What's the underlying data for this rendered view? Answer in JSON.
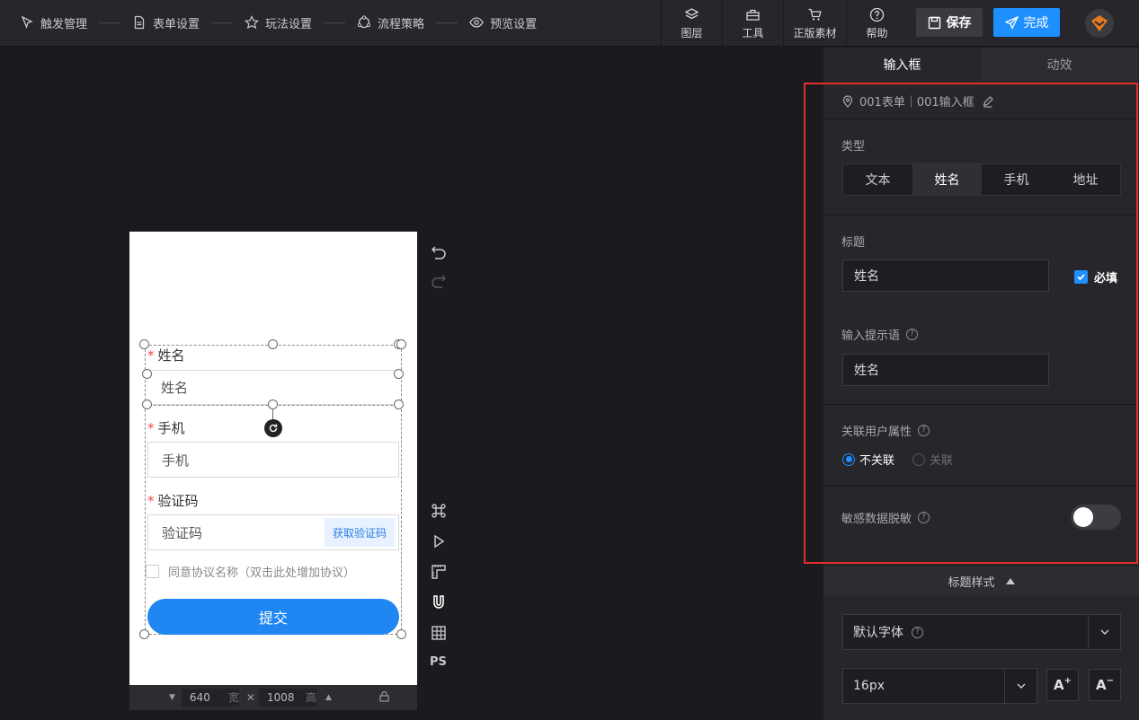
{
  "steps": [
    {
      "label": "触发管理",
      "icon": "cursor-icon"
    },
    {
      "label": "表单设置",
      "icon": "document-icon"
    },
    {
      "label": "玩法设置",
      "icon": "star-icon"
    },
    {
      "label": "流程策略",
      "icon": "flow-icon"
    },
    {
      "label": "预览设置",
      "icon": "eye-icon"
    }
  ],
  "tools": {
    "layers": "图层",
    "tools": "工具",
    "assets": "正版素材",
    "help": "帮助"
  },
  "buttons": {
    "save": "保存",
    "done": "完成"
  },
  "phone": {
    "name_label": "姓名",
    "name_placeholder": "姓名",
    "phone_label": "手机",
    "phone_placeholder": "手机",
    "code_label": "验证码",
    "code_placeholder": "验证码",
    "get_code": "获取验证码",
    "agree_text": "同意协议名称（双击此处增加协议）",
    "submit": "提交",
    "required_mark": "*"
  },
  "sizebar": {
    "width_value": "640",
    "width_unit": "宽",
    "times": "✕",
    "height_value": "1008",
    "height_unit": "高"
  },
  "panel": {
    "tabs": [
      "输入框",
      "动效"
    ],
    "breadcrumb": "001表单｜001输入框",
    "type_label": "类型",
    "types": [
      "文本",
      "姓名",
      "手机",
      "地址"
    ],
    "active_type": "姓名",
    "title_label": "标题",
    "title_value": "姓名",
    "required_label": "必填",
    "placeholder_label": "输入提示语",
    "placeholder_value": "姓名",
    "user_attr_label": "关联用户属性",
    "user_attr_options": [
      "不关联",
      "关联"
    ],
    "user_attr_selected": "不关联",
    "mask_label": "敏感数据脱敏",
    "mask_enabled": false,
    "title_style_label": "标题样式",
    "font_value": "默认字体",
    "size_value": "16px",
    "font_up": "A",
    "font_down": "A",
    "ps_label": "PS"
  },
  "colors": {
    "accent": "#1e8fff",
    "highlight": "#e2302b",
    "required": "#f04a4a",
    "submit": "#1f86f2"
  }
}
